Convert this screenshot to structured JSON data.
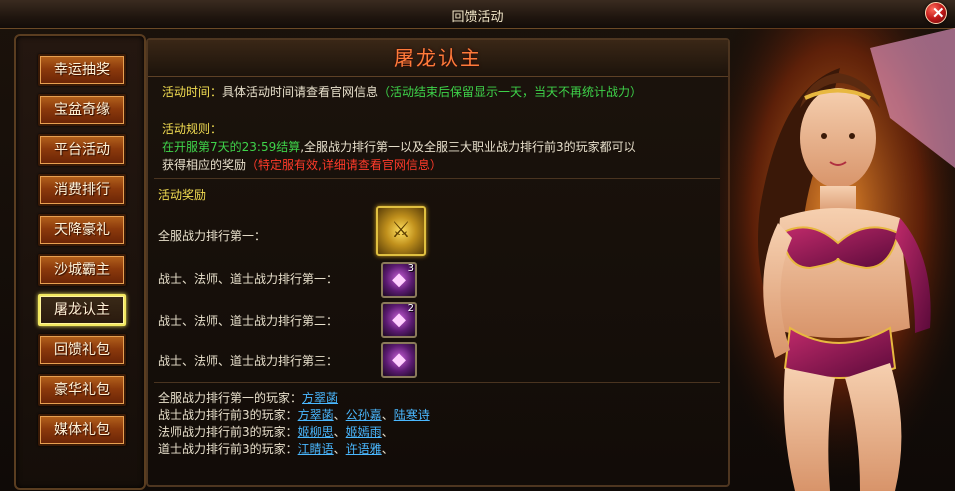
{
  "window": {
    "title": "回馈活动"
  },
  "nav": [
    {
      "label": "幸运抽奖",
      "active": false
    },
    {
      "label": "宝盆奇缘",
      "active": false
    },
    {
      "label": "平台活动",
      "active": false
    },
    {
      "label": "消费排行",
      "active": false
    },
    {
      "label": "天降豪礼",
      "active": false
    },
    {
      "label": "沙城霸主",
      "active": false
    },
    {
      "label": "屠龙认主",
      "active": true
    },
    {
      "label": "回馈礼包",
      "active": false
    },
    {
      "label": "豪华礼包",
      "active": false
    },
    {
      "label": "媒体礼包",
      "active": false
    }
  ],
  "content": {
    "heading": "屠龙认主",
    "time_label": "活动时间：",
    "time_text": "具体活动时间请查看官网信息",
    "time_note": "（活动结束后保留显示一天，当天不再统计战力）",
    "rules_label": "活动规则：",
    "rules_green": "在开服第7天的23:59结算",
    "rules_text_1": ",全服战力排行第一以及全服三大职业战力排行前3的玩家都可以",
    "rules_text_2": "获得相应的奖励",
    "rules_note": "（特定服有效,详细请查看官网信息）",
    "rewards_heading": "活动奖励",
    "rewards": [
      {
        "label": "全服战力排行第一：",
        "item": "weapon-icon",
        "count": ""
      },
      {
        "label": "战士、法师、道士战力排行第一：",
        "item": "potion-bag-icon",
        "count": "3"
      },
      {
        "label": "战士、法师、道士战力排行第二：",
        "item": "potion-bag-icon",
        "count": "2"
      },
      {
        "label": "战士、法师、道士战力排行第三：",
        "item": "potion-bag-icon",
        "count": ""
      }
    ],
    "rankings": [
      {
        "label": "全服战力排行第一的玩家：",
        "players": [
          "方翠菡"
        ]
      },
      {
        "label": "战士战力排行前3的玩家：",
        "players": [
          "方翠菡",
          "公孙嘉",
          "陆寒诗"
        ]
      },
      {
        "label": "法师战力排行前3的玩家：",
        "players": [
          "姬柳思",
          "姬嫣雨"
        ]
      },
      {
        "label": "道士战力排行前3的玩家：",
        "players": [
          "江睛语",
          "许语雅"
        ]
      }
    ]
  },
  "colors": {
    "heading": "#ff7a3a",
    "label_yellow": "#f2dd52",
    "note_green": "#3ed34a",
    "note_red": "#ff3a2a",
    "link_blue": "#4ab8ff"
  }
}
